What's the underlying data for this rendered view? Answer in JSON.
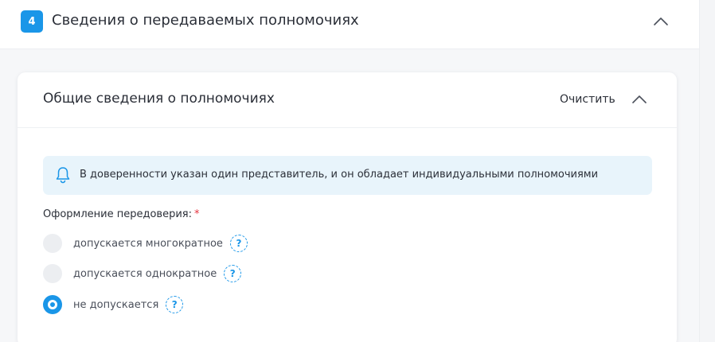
{
  "section": {
    "step_number": "4",
    "title": "Сведения о передаваемых полномочиях",
    "collapse_icon": "chevron-up-icon"
  },
  "card": {
    "title": "Общие сведения о полномочиях",
    "clear_label": "Очистить",
    "collapse_icon": "chevron-up-icon"
  },
  "info": {
    "icon": "bell-icon",
    "text": "В доверенности указан один представитель, и он обладает индивидуальными полномочиями"
  },
  "redelegation": {
    "label": "Оформление передоверия:",
    "required_mark": "*",
    "options": [
      {
        "label": "допускается многократное",
        "selected": false,
        "help": "?"
      },
      {
        "label": "допускается однократное",
        "selected": false,
        "help": "?"
      },
      {
        "label": "не допускается",
        "selected": true,
        "help": "?"
      }
    ],
    "selected_value": "не допускается"
  },
  "colors": {
    "accent": "#1a96e8",
    "info_background": "#e8f4fb",
    "required": "#e5333f"
  }
}
